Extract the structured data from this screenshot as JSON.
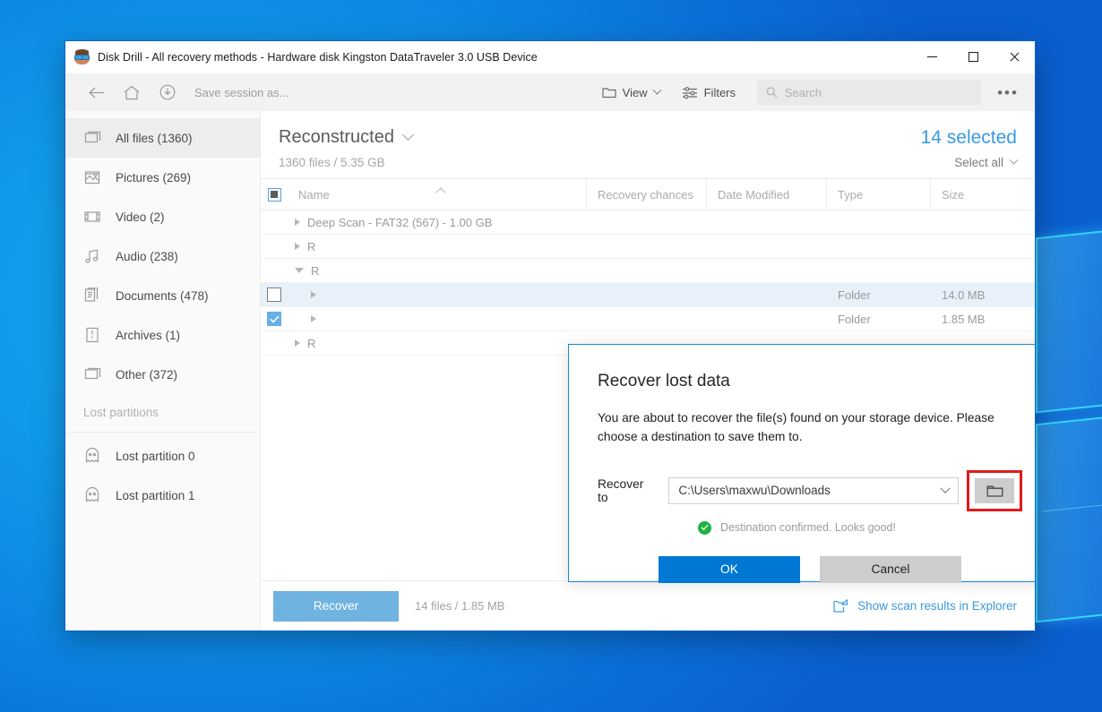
{
  "window": {
    "title": "Disk Drill - All recovery methods - Hardware disk Kingston DataTraveler 3.0 USB Device",
    "app_icon": "disk-drill-mascot-icon",
    "minimize_label": "Minimize",
    "maximize_label": "Maximize",
    "close_label": "Close"
  },
  "toolbar": {
    "back_icon": "back-arrow-icon",
    "home_icon": "home-icon",
    "save_icon": "save-session-icon",
    "save_session_label": "Save session as...",
    "view_label": "View",
    "view_icon": "folder-icon",
    "filters_label": "Filters",
    "filters_icon": "filters-sliders-icon",
    "search_placeholder": "Search",
    "search_value": "",
    "search_icon": "search-icon",
    "more_label": "•••"
  },
  "sidebar": {
    "items": [
      {
        "label": "All files (1360)",
        "icon": "all-files-icon",
        "active": true
      },
      {
        "label": "Pictures (269)",
        "icon": "pictures-icon",
        "active": false
      },
      {
        "label": "Video (2)",
        "icon": "video-icon",
        "active": false
      },
      {
        "label": "Audio (238)",
        "icon": "audio-icon",
        "active": false
      },
      {
        "label": "Documents (478)",
        "icon": "documents-icon",
        "active": false
      },
      {
        "label": "Archives (1)",
        "icon": "archives-icon",
        "active": false
      },
      {
        "label": "Other (372)",
        "icon": "other-icon",
        "active": false
      }
    ],
    "section_label": "Lost partitions",
    "partitions": [
      {
        "label": "Lost partition 0",
        "icon": "lost-partition-ghost-icon"
      },
      {
        "label": "Lost partition 1",
        "icon": "lost-partition-ghost-icon"
      }
    ]
  },
  "main": {
    "title": "Reconstructed",
    "title_chevron_icon": "chevron-down-icon",
    "subtitle": "1360 files / 5.35 GB",
    "selected_count": "14 selected",
    "select_all_label": "Select all",
    "select_all_chevron_icon": "chevron-down-icon",
    "accent_color": "#3a9ae0",
    "columns": {
      "checkbox": "",
      "name": "Name",
      "recovery_chances": "Recovery chances",
      "date_modified": "Date Modified",
      "type": "Type",
      "size": "Size"
    },
    "rows": [
      {
        "name": "Deep Scan - FAT32 (567) - 1.00 GB",
        "chances": "",
        "date": "",
        "type": "",
        "size": "",
        "toggle": "collapsed",
        "checkbox": "none",
        "selected": false,
        "indent": 0
      },
      {
        "name": "R",
        "chances": "",
        "date": "",
        "type": "",
        "size": "",
        "toggle": "collapsed",
        "checkbox": "none",
        "selected": false,
        "indent": 0
      },
      {
        "name": "R",
        "chances": "",
        "date": "",
        "type": "",
        "size": "",
        "toggle": "expanded",
        "checkbox": "none",
        "selected": false,
        "indent": 0
      },
      {
        "name": "",
        "chances": "",
        "date": "",
        "type": "Folder",
        "size": "14.0 MB",
        "toggle": "collapsed",
        "checkbox": "unchecked",
        "selected": true,
        "indent": 1
      },
      {
        "name": "",
        "chances": "",
        "date": "",
        "type": "Folder",
        "size": "1.85 MB",
        "toggle": "collapsed",
        "checkbox": "checked",
        "selected": false,
        "indent": 1
      },
      {
        "name": "R",
        "chances": "",
        "date": "",
        "type": "",
        "size": "",
        "toggle": "collapsed",
        "checkbox": "none",
        "selected": false,
        "indent": 0
      }
    ]
  },
  "bottom": {
    "recover_label": "Recover",
    "stats": "14 files / 1.85 MB",
    "explorer_link": "Show scan results in Explorer",
    "explorer_icon": "open-in-explorer-icon"
  },
  "dialog": {
    "title": "Recover lost data",
    "body": "You are about to recover the file(s) found on your storage device. Please choose a destination to save them to.",
    "recover_to_label": "Recover to",
    "destination_value": "C:\\Users\\maxwu\\Downloads",
    "destination_chevron_icon": "chevron-down-icon",
    "browse_icon": "folder-browse-icon",
    "browse_highlight_color": "#e01b1b",
    "status_text": "Destination confirmed. Looks good!",
    "status_icon": "check-circle-icon",
    "status_color": "#1fb33f",
    "ok_label": "OK",
    "cancel_label": "Cancel",
    "ok_color": "#0078d4"
  }
}
